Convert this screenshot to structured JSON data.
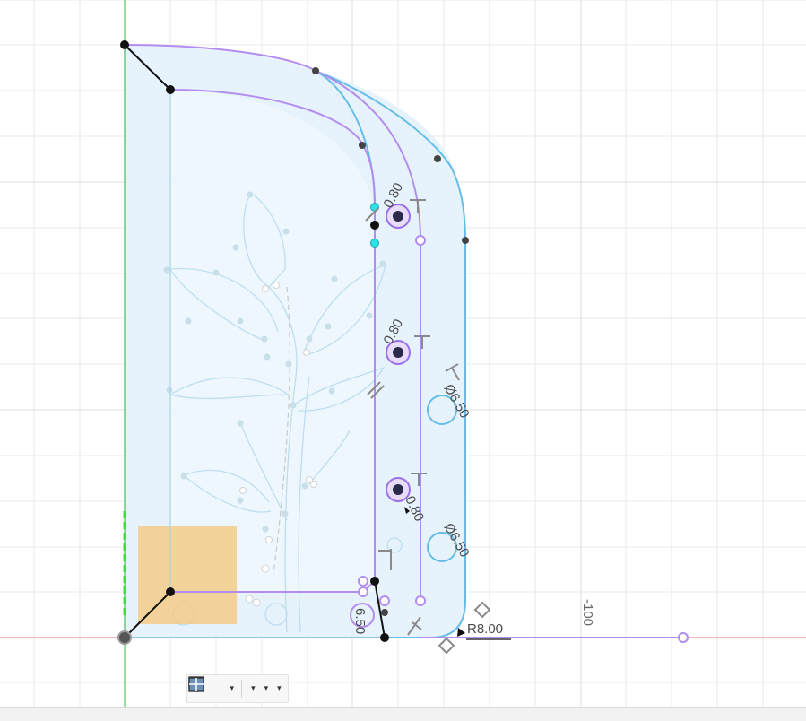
{
  "viewport": {
    "dimensions": {
      "radius_label": "R8.00",
      "axis_tick_label": "-100",
      "circle_labels": [
        "0.80",
        "0.80",
        "0.80",
        "Ø6.50",
        "Ø6.50",
        "6.50"
      ]
    }
  },
  "toolbar": {
    "items": [
      {
        "name": "orbit",
        "has_menu": true
      },
      {
        "name": "look-at",
        "has_menu": false
      },
      {
        "name": "pan",
        "has_menu": false
      },
      {
        "name": "zoom",
        "has_menu": false
      },
      {
        "name": "fit",
        "has_menu": true
      },
      {
        "name": "display-settings",
        "has_menu": true
      },
      {
        "name": "grid-and-snaps",
        "has_menu": true
      },
      {
        "name": "viewports",
        "has_menu": true
      }
    ]
  },
  "colors": {
    "sketch_fill": "#e3f1fb",
    "profile_purple": "#b38cf0",
    "profile_blue": "#63bde6",
    "x_axis": "#e26b6b",
    "y_axis": "#3cb43c",
    "selected_region": "#f5c77a"
  }
}
